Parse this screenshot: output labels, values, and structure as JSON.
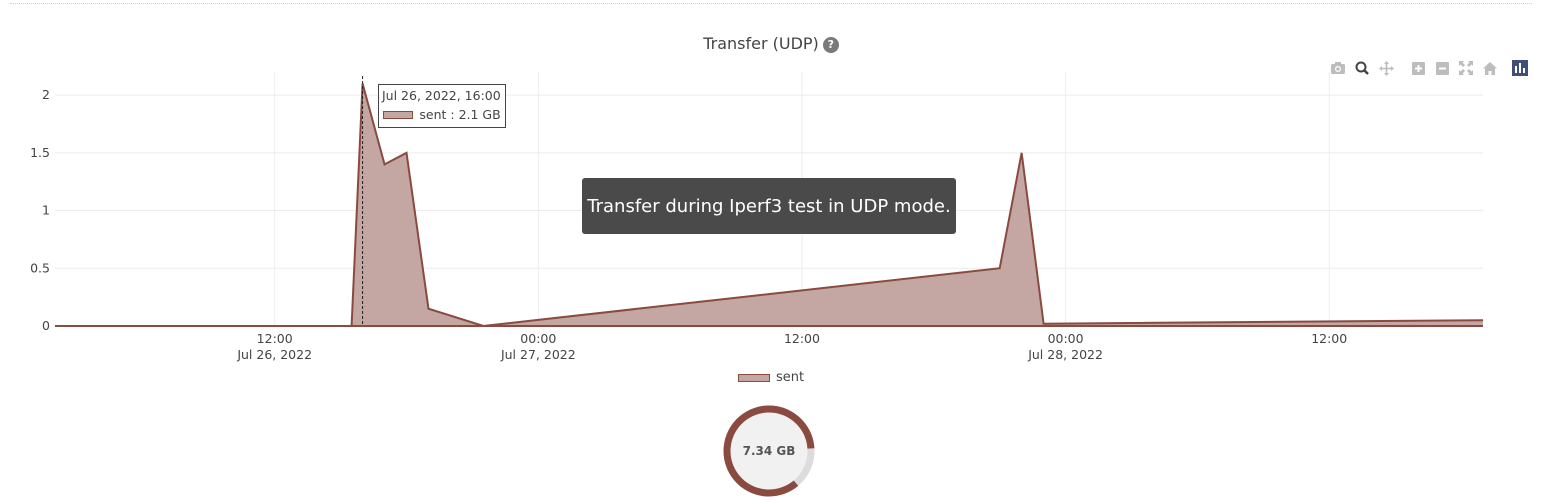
{
  "title": "Transfer (UDP)",
  "help_icon": "question-circle-icon",
  "tooltip_text": "Transfer during Iperf3 test in UDP mode.",
  "hover": {
    "date": "Jul 26, 2022, 16:00",
    "label": "sent : 2.1 GB"
  },
  "modebar": [
    "camera-icon",
    "zoom-icon",
    "pan-icon",
    "zoom-in-icon",
    "zoom-out-icon",
    "autoscale-icon",
    "reset-axes-icon",
    "plotly-logo-icon"
  ],
  "total_label": "7.34 GB",
  "colors": {
    "line": "#8a4a40",
    "fill": "#c4a6a2",
    "donut_track": "#dcdcdc",
    "donut_center": "#f1f1f1"
  },
  "chart_data": {
    "type": "area",
    "title": "Transfer (UDP)",
    "x": [
      "2022-07-26 02:00",
      "2022-07-26 14:30",
      "2022-07-26 15:30",
      "2022-07-26 16:00",
      "2022-07-26 17:00",
      "2022-07-26 18:00",
      "2022-07-26 19:00",
      "2022-07-26 21:30",
      "2022-07-27 21:00",
      "2022-07-27 22:00",
      "2022-07-27 23:00",
      "2022-07-28 19:00"
    ],
    "series": [
      {
        "name": "sent",
        "values": [
          0,
          0,
          0,
          2.1,
          1.4,
          1.5,
          0.15,
          0,
          0.5,
          1.5,
          0.02,
          0.05
        ]
      }
    ],
    "ylim": [
      0,
      2.2
    ],
    "yticks": [
      "0",
      "0.5",
      "1",
      "1.5",
      "2"
    ],
    "xticks": [
      {
        "time": "12:00",
        "date": "Jul 26, 2022"
      },
      {
        "time": "00:00",
        "date": "Jul 27, 2022"
      },
      {
        "time": "12:00",
        "date": ""
      },
      {
        "time": "00:00",
        "date": "Jul 28, 2022"
      },
      {
        "time": "12:00",
        "date": ""
      }
    ],
    "legend": [
      "sent"
    ],
    "grid": true,
    "total": {
      "label": "7.34 GB",
      "fraction": 0.85
    }
  }
}
